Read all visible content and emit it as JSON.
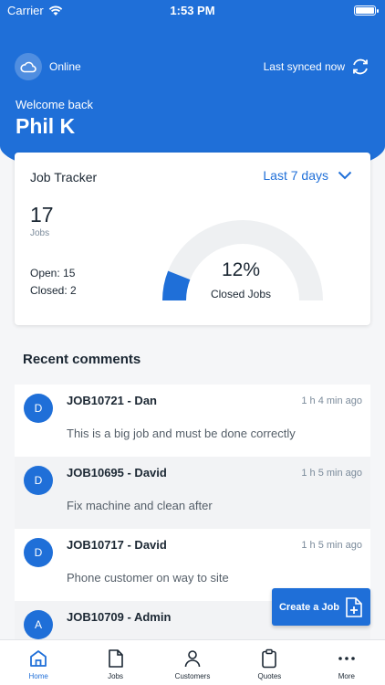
{
  "status_bar": {
    "carrier": "Carrier",
    "time": "1:53 PM"
  },
  "header": {
    "connection_status": "Online",
    "sync_status": "Last synced now",
    "welcome": "Welcome back",
    "user_name": "Phil K"
  },
  "job_tracker": {
    "title": "Job Tracker",
    "range_label": "Last 7 days",
    "jobs_count": "17",
    "jobs_label": "Jobs",
    "open_text": "Open: 15",
    "closed_text": "Closed: 2",
    "closed_percent_text": "12%",
    "closed_fraction": 0.12,
    "gauge_label": "Closed Jobs"
  },
  "recent_comments": {
    "title": "Recent comments",
    "items": [
      {
        "initial": "D",
        "title": "JOB10721 - Dan",
        "time": "1 h 4 min ago",
        "text": "This is a big job and must be done correctly"
      },
      {
        "initial": "D",
        "title": "JOB10695 - David",
        "time": "1 h 5 min ago",
        "text": "Fix machine and clean after"
      },
      {
        "initial": "D",
        "title": "JOB10717 - David",
        "time": "1 h 5 min ago",
        "text": "Phone customer on way to site"
      },
      {
        "initial": "A",
        "title": "JOB10709 - Admin",
        "time": "",
        "text": ""
      }
    ]
  },
  "create_job_label": "Create a Job",
  "tabs": [
    {
      "label": "Home",
      "icon": "home-icon"
    },
    {
      "label": "Jobs",
      "icon": "document-icon"
    },
    {
      "label": "Customers",
      "icon": "person-icon"
    },
    {
      "label": "Quotes",
      "icon": "clipboard-icon"
    },
    {
      "label": "More",
      "icon": "more-icon"
    }
  ],
  "colors": {
    "primary": "#1f6fd8",
    "gauge_track": "#eef0f2"
  }
}
